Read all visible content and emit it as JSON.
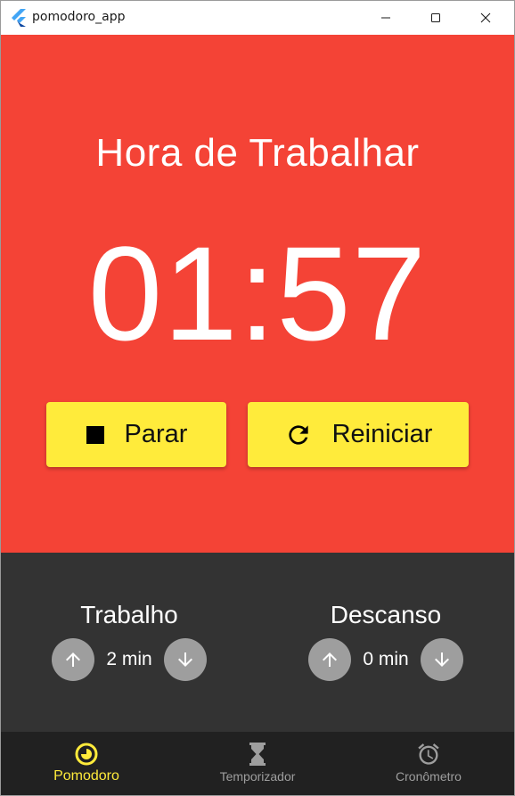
{
  "window": {
    "title": "pomodoro_app"
  },
  "main": {
    "mode_title": "Hora de Trabalhar",
    "timer": "01:57",
    "background_color": "#f44336",
    "stop_button": {
      "label": "Parar",
      "icon": "stop-icon"
    },
    "reset_button": {
      "label": "Reiniciar",
      "icon": "refresh-icon"
    },
    "button_color": "#ffeb3b"
  },
  "settings": {
    "work": {
      "label": "Trabalho",
      "value": "2 min"
    },
    "rest": {
      "label": "Descanso",
      "value": "0 min"
    },
    "background_color": "#333333"
  },
  "nav": {
    "items": [
      {
        "label": "Pomodoro",
        "icon": "pomodoro-icon",
        "active": true
      },
      {
        "label": "Temporizador",
        "icon": "hourglass-icon",
        "active": false
      },
      {
        "label": "Cronômetro",
        "icon": "alarm-clock-icon",
        "active": false
      }
    ],
    "active_color": "#ffeb3b",
    "inactive_color": "#9e9e9e"
  }
}
